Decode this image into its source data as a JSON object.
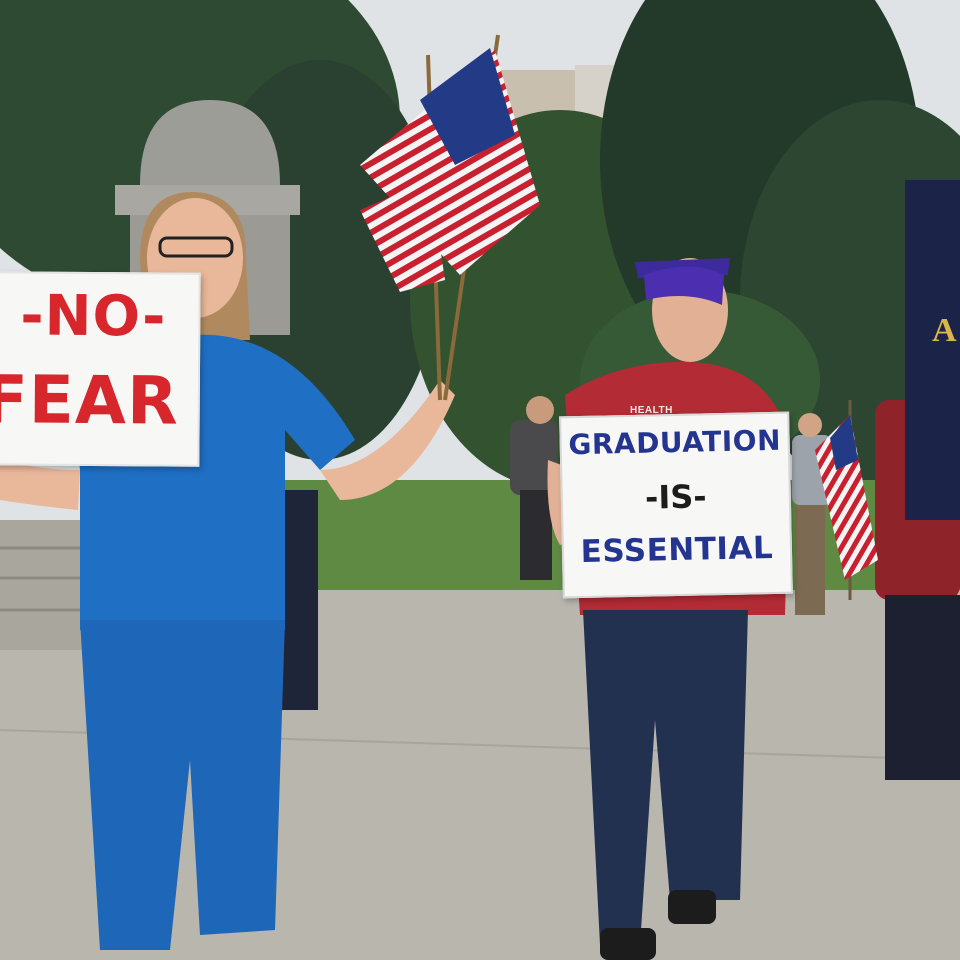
{
  "photo": {
    "setting": "outdoor plaza protest with trees, lawn, stone monument and building"
  },
  "left_sign": {
    "line1": "-NO-",
    "line2": "FEAR",
    "text_color": "#d7262c"
  },
  "right_sign": {
    "line1": "GRADUATION",
    "line2": "-IS-",
    "line3": "ESSENTIAL",
    "text_color": "#24358f"
  },
  "shirt_print": "HEALTH",
  "banner_letter": "A",
  "colors": {
    "scrubs_blue": "#1f6fc4",
    "shirt_red": "#b32b34",
    "cap_purple": "#4b2fb0",
    "flag_red": "#c8202e",
    "flag_blue": "#233b86"
  }
}
